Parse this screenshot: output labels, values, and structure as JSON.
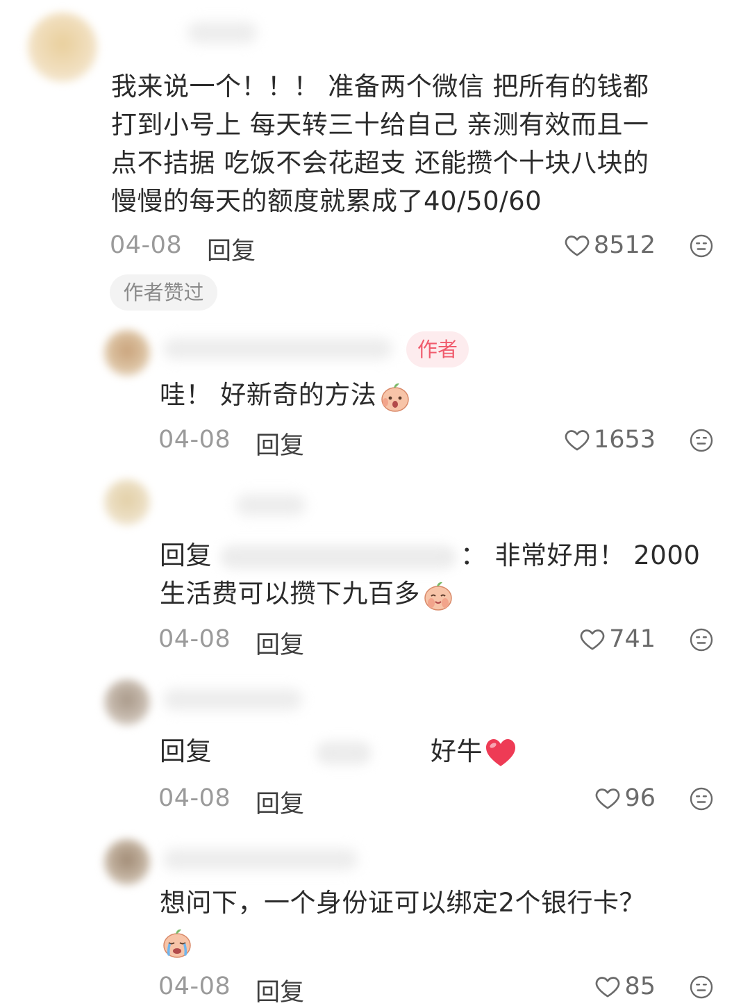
{
  "comments": [
    {
      "text_lines": [
        "我来说一个！！！ 准备两个微信 把所有的钱都",
        "打到小号上 每天转三十给自己 亲测有效而且一",
        "点不拮据 吃饭不会花超支 还能攒个十块八块的",
        "慢慢的每天的额度就累成了40/50/60"
      ],
      "date": "04-08",
      "reply_label": "回复",
      "likes": "8512",
      "badge": "作者赞过"
    },
    {
      "author_badge": "作者",
      "text": "哇！ 好新奇的方法",
      "emoji": "surprised-peach-emoji",
      "date": "04-08",
      "reply_label": "回复",
      "likes": "1653"
    },
    {
      "reply_prefix": "回复",
      "reply_suffix": "：",
      "text_line1": "非常好用！ 2000",
      "text_line2": "生活费可以攒下九百多",
      "emoji": "shy-peach-emoji",
      "date": "04-08",
      "reply_label": "回复",
      "likes": "741"
    },
    {
      "reply_prefix": "回复",
      "text": "好牛",
      "emoji": "red-heart-emoji",
      "date": "04-08",
      "reply_label": "回复",
      "likes": "96"
    },
    {
      "text": "想问下，一个身份证可以绑定2个银行卡？",
      "emoji": "crying-peach-emoji",
      "date": "04-08",
      "reply_label": "回复",
      "likes": "85"
    }
  ],
  "colors": {
    "like_icon": "#6a6a6a",
    "author_badge_bg": "#fdecee",
    "author_badge_text": "#f05b6d",
    "liked_badge_bg": "#f3f3f3"
  }
}
